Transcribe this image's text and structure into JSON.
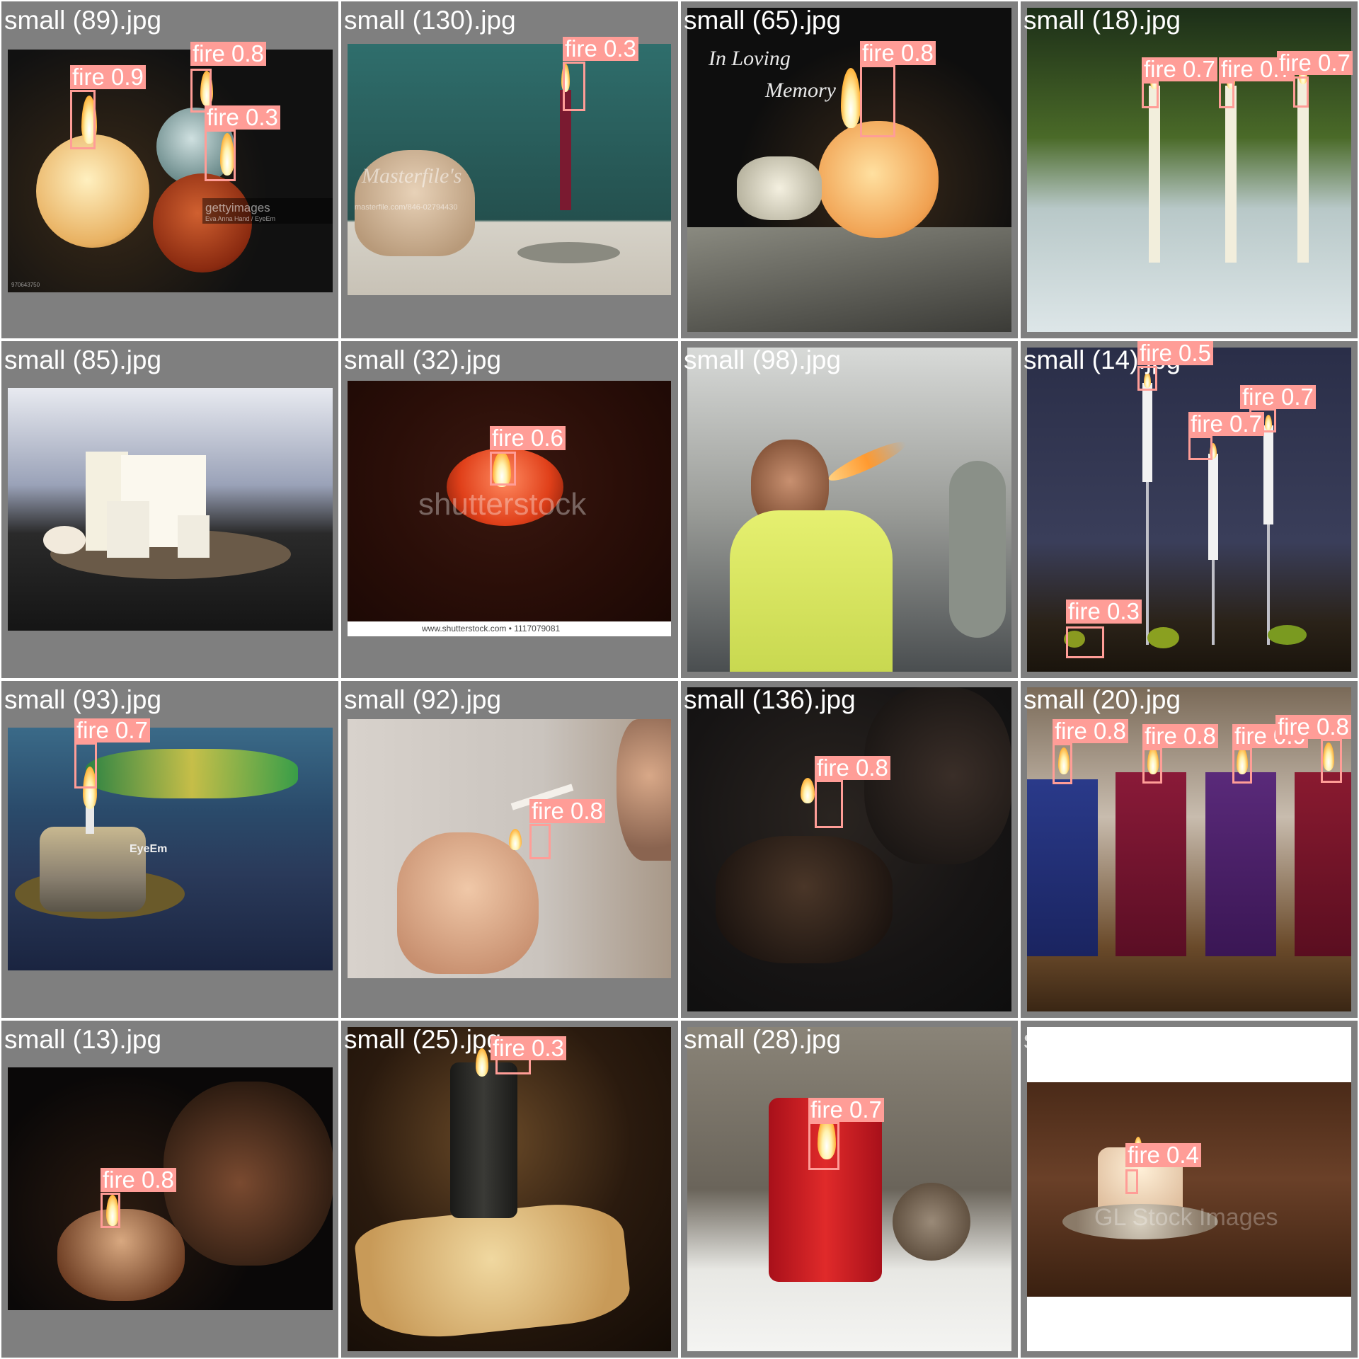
{
  "label_color": "#ff9d97",
  "tiles": [
    {
      "filename": "small (89).jpg",
      "watermarks": [
        "gettyimages",
        "Eva Anna Hand / EyeEm",
        "970643750"
      ],
      "detections": [
        {
          "label": "fire 0.9"
        },
        {
          "label": "fire 0.8"
        },
        {
          "label": "fire 0.3"
        }
      ]
    },
    {
      "filename": "small (130).jpg",
      "watermarks": [
        "Masterfile's",
        "masterfile.com/846-02794430"
      ],
      "detections": [
        {
          "label": "fire 0.3"
        }
      ]
    },
    {
      "filename": "small (65).jpg",
      "watermarks": [
        "In Loving",
        "Memory"
      ],
      "detections": [
        {
          "label": "fire 0.8"
        }
      ]
    },
    {
      "filename": "small (18).jpg",
      "watermarks": [],
      "detections": [
        {
          "label": "fire 0.7"
        },
        {
          "label": "fire 0.7"
        },
        {
          "label": "fire 0.7"
        }
      ]
    },
    {
      "filename": "small (85).jpg",
      "watermarks": [],
      "detections": []
    },
    {
      "filename": "small (32).jpg",
      "watermarks": [
        "shutterstock",
        "www.shutterstock.com • 1117079081"
      ],
      "detections": [
        {
          "label": "fire 0.6"
        }
      ]
    },
    {
      "filename": "small (98).jpg",
      "watermarks": [],
      "detections": []
    },
    {
      "filename": "small (14).jpg",
      "watermarks": [],
      "detections": [
        {
          "label": "fire 0.5"
        },
        {
          "label": "fire 0.7"
        },
        {
          "label": "fire 0.7"
        },
        {
          "label": "fire 0.3"
        }
      ]
    },
    {
      "filename": "small (93).jpg",
      "watermarks": [
        "EyeEm"
      ],
      "detections": [
        {
          "label": "fire 0.7"
        }
      ]
    },
    {
      "filename": "small (92).jpg",
      "watermarks": [],
      "detections": [
        {
          "label": "fire 0.8"
        }
      ]
    },
    {
      "filename": "small (136).jpg",
      "watermarks": [],
      "detections": [
        {
          "label": "fire 0.8"
        }
      ]
    },
    {
      "filename": "small (20).jpg",
      "watermarks": [],
      "detections": [
        {
          "label": "fire 0.8"
        },
        {
          "label": "fire 0.8"
        },
        {
          "label": "fire 0.9"
        },
        {
          "label": "fire 0.8"
        }
      ]
    },
    {
      "filename": "small (13).jpg",
      "watermarks": [],
      "detections": [
        {
          "label": "fire 0.8"
        }
      ]
    },
    {
      "filename": "small (25).jpg",
      "watermarks": [],
      "detections": [
        {
          "label": "fire 0.3"
        }
      ]
    },
    {
      "filename": "small (28).jpg",
      "watermarks": [],
      "detections": [
        {
          "label": "fire 0.7"
        }
      ]
    },
    {
      "filename": "small (129).jpg",
      "watermarks": [
        "GL Stock Images"
      ],
      "detections": [
        {
          "label": "fire 0.4"
        }
      ]
    }
  ]
}
